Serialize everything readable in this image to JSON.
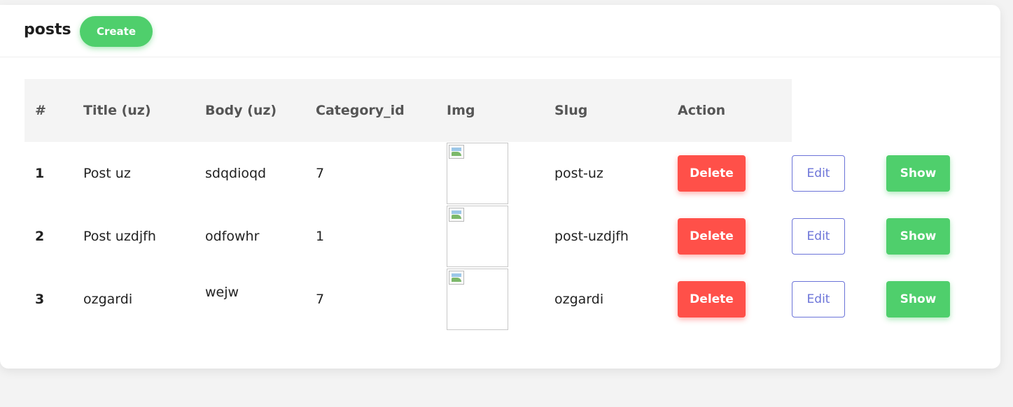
{
  "header": {
    "title": "posts",
    "create_label": "Create"
  },
  "table": {
    "columns": [
      "#",
      "Title (uz)",
      "Body (uz)",
      "Category_id",
      "Img",
      "Slug",
      "Action"
    ],
    "rows": [
      {
        "num": "1",
        "title": "Post uz",
        "body": "sdqdioqd",
        "category_id": "7",
        "slug": "post-uz"
      },
      {
        "num": "2",
        "title": "Post uzdjfh",
        "body": "odfowhr",
        "category_id": "1",
        "slug": "post-uzdjfh"
      },
      {
        "num": "3",
        "title": "ozgardi",
        "body": "wejw",
        "category_id": "7",
        "slug": "ozgardi"
      }
    ],
    "actions": {
      "delete_label": "Delete",
      "edit_label": "Edit",
      "show_label": "Show"
    }
  },
  "colors": {
    "create": "#4fcf6c",
    "delete": "#ff5049",
    "edit": "#6b73d8",
    "show": "#4fcf6c"
  },
  "icons": {
    "img_placeholder": "broken-image-icon"
  }
}
